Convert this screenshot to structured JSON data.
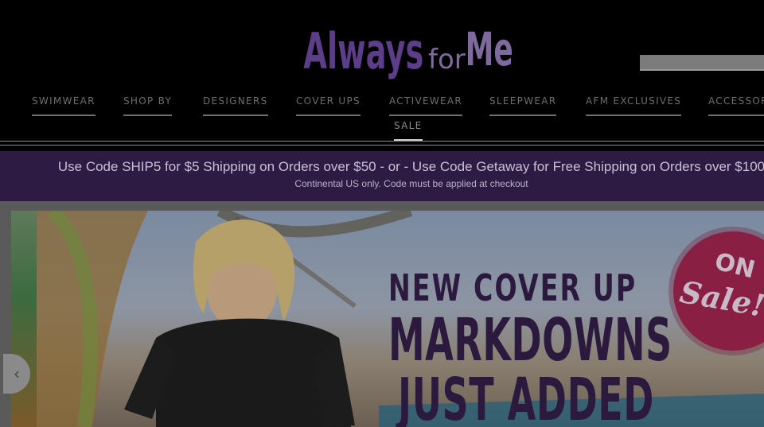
{
  "brand": {
    "name": "Always for Me",
    "logo_icon": "always-for-me-logo",
    "colors": {
      "logo_purple": "#5c3d88",
      "logo_light": "#7f6a9e",
      "promo_bg": "#2d1b44",
      "headline": "#2c1a3e",
      "badge": "#8a1f44"
    }
  },
  "search": {
    "placeholder": "",
    "value": ""
  },
  "nav": {
    "items": [
      {
        "label": "SWIMWEAR"
      },
      {
        "label": "SHOP BY"
      },
      {
        "label": "DESIGNERS"
      },
      {
        "label": "COVER UPS"
      },
      {
        "label": "ACTIVEWEAR"
      },
      {
        "label": "SLEEPWEAR"
      },
      {
        "label": "AFM EXCLUSIVES"
      },
      {
        "label": "ACCESSORIES"
      },
      {
        "label": "SALE"
      }
    ]
  },
  "promo": {
    "main": "Use Code SHIP5 for $5 Shipping on Orders over $50 - or - Use Code Getaway for Free Shipping on Orders over $100",
    "sub": "Continental US only. Code must be applied at checkout"
  },
  "hero": {
    "line1": "NEW COVER UP",
    "line2": "MARKDOWNS",
    "line3": "JUST ADDED",
    "badge_on": "ON",
    "badge_sale": "Sale!",
    "prev_icon": "chevron-left-icon",
    "prev_glyph": "‹"
  }
}
